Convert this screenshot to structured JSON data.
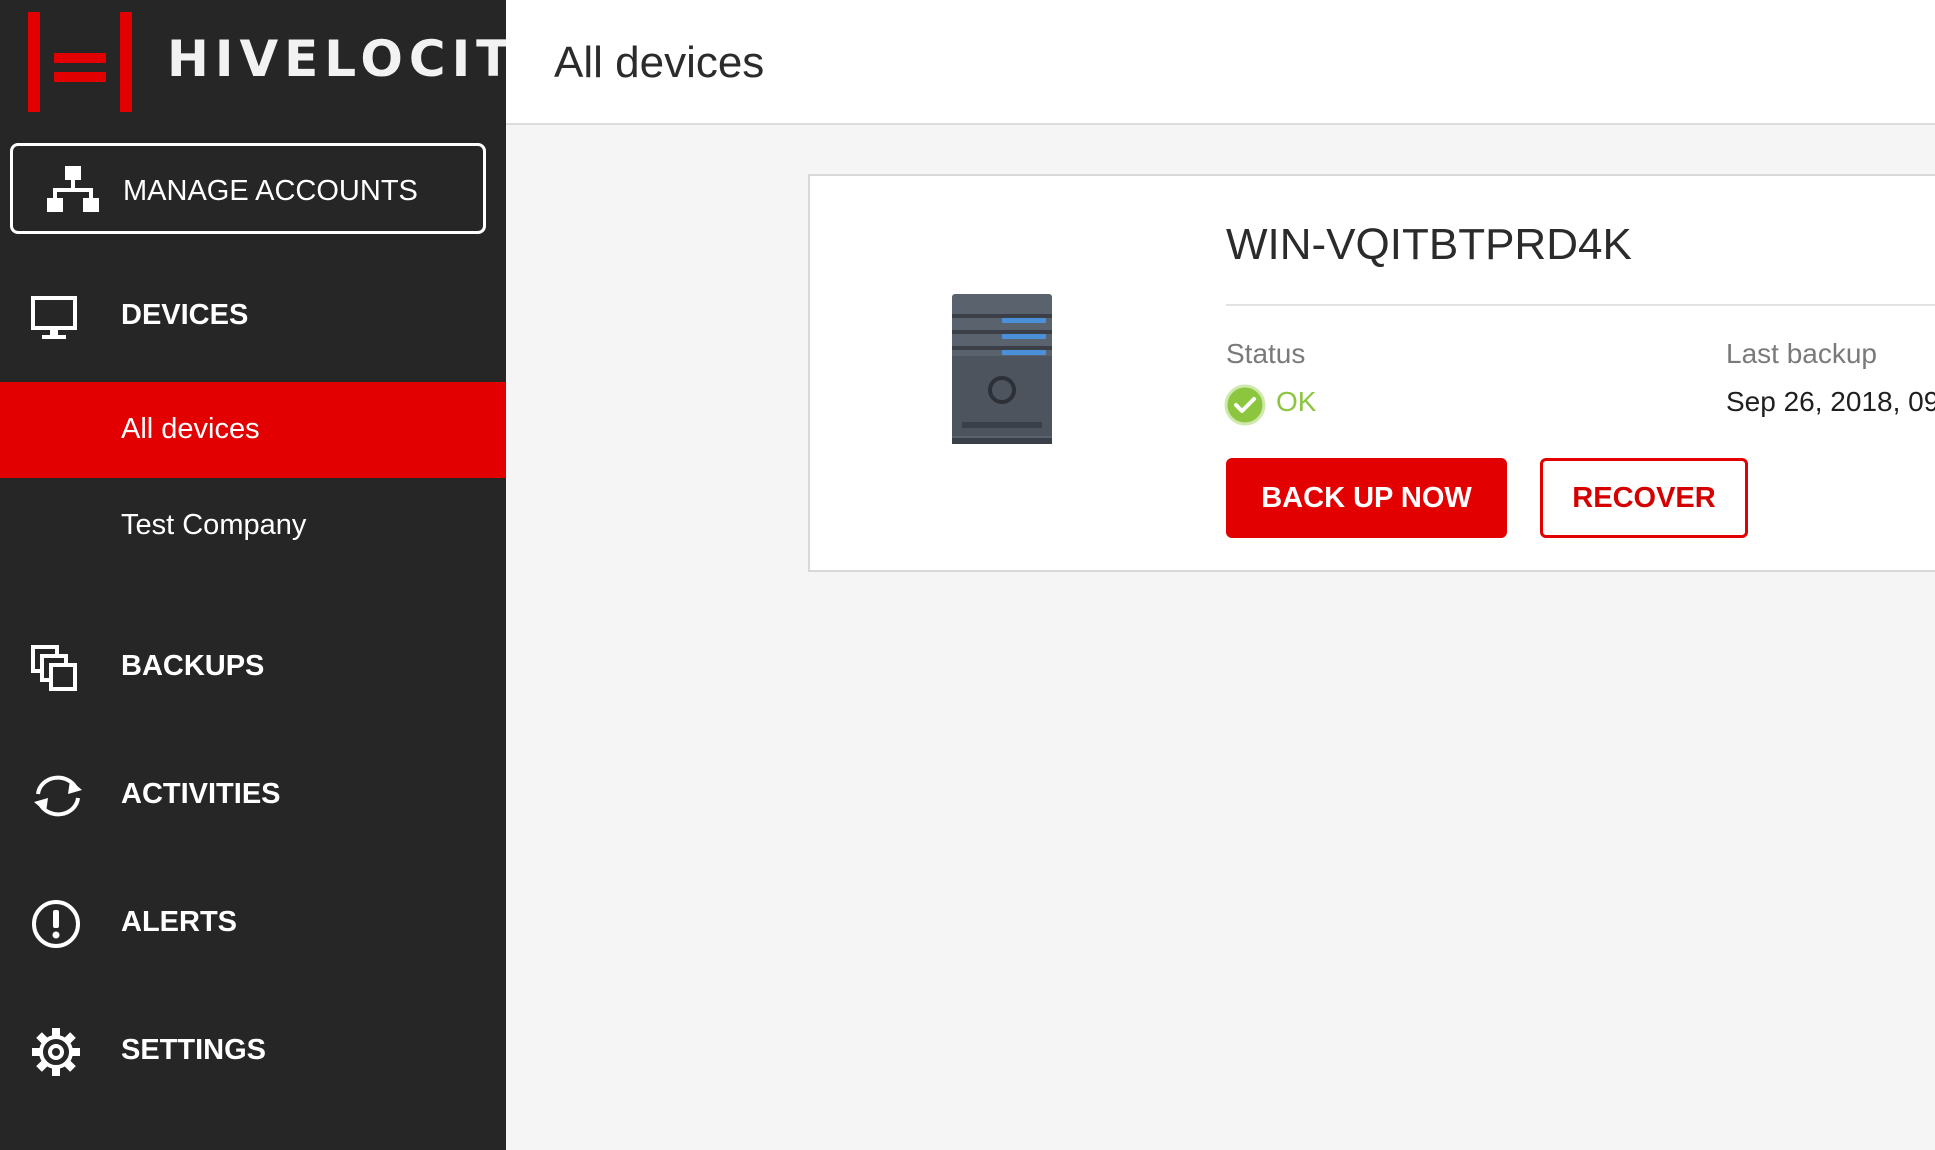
{
  "brand": {
    "name": "HIVELOCITY",
    "accent": "#e20000"
  },
  "sidebar": {
    "manage_accounts": "MANAGE ACCOUNTS",
    "devices": {
      "label": "DEVICES",
      "children": [
        "All devices",
        "Test Company"
      ]
    },
    "backups": "BACKUPS",
    "activities": "ACTIVITIES",
    "alerts": "ALERTS",
    "settings": "SETTINGS"
  },
  "header": {
    "title": "All devices"
  },
  "device": {
    "name": "WIN-VQITBTPRD4K",
    "status_label": "Status",
    "status_value": "OK",
    "status_color": "#8cc63f",
    "last_backup_label": "Last backup",
    "last_backup_value": "Sep 26, 2018, 09",
    "back_up_now": "BACK UP NOW",
    "recover": "RECOVER"
  },
  "icons": {
    "manage": "sitemap-icon",
    "devices": "monitor-icon",
    "backups": "copies-icon",
    "activities": "sync-icon",
    "alerts": "alert-icon",
    "settings": "gear-icon",
    "device": "server-tower-icon",
    "status": "check-circle-icon"
  }
}
